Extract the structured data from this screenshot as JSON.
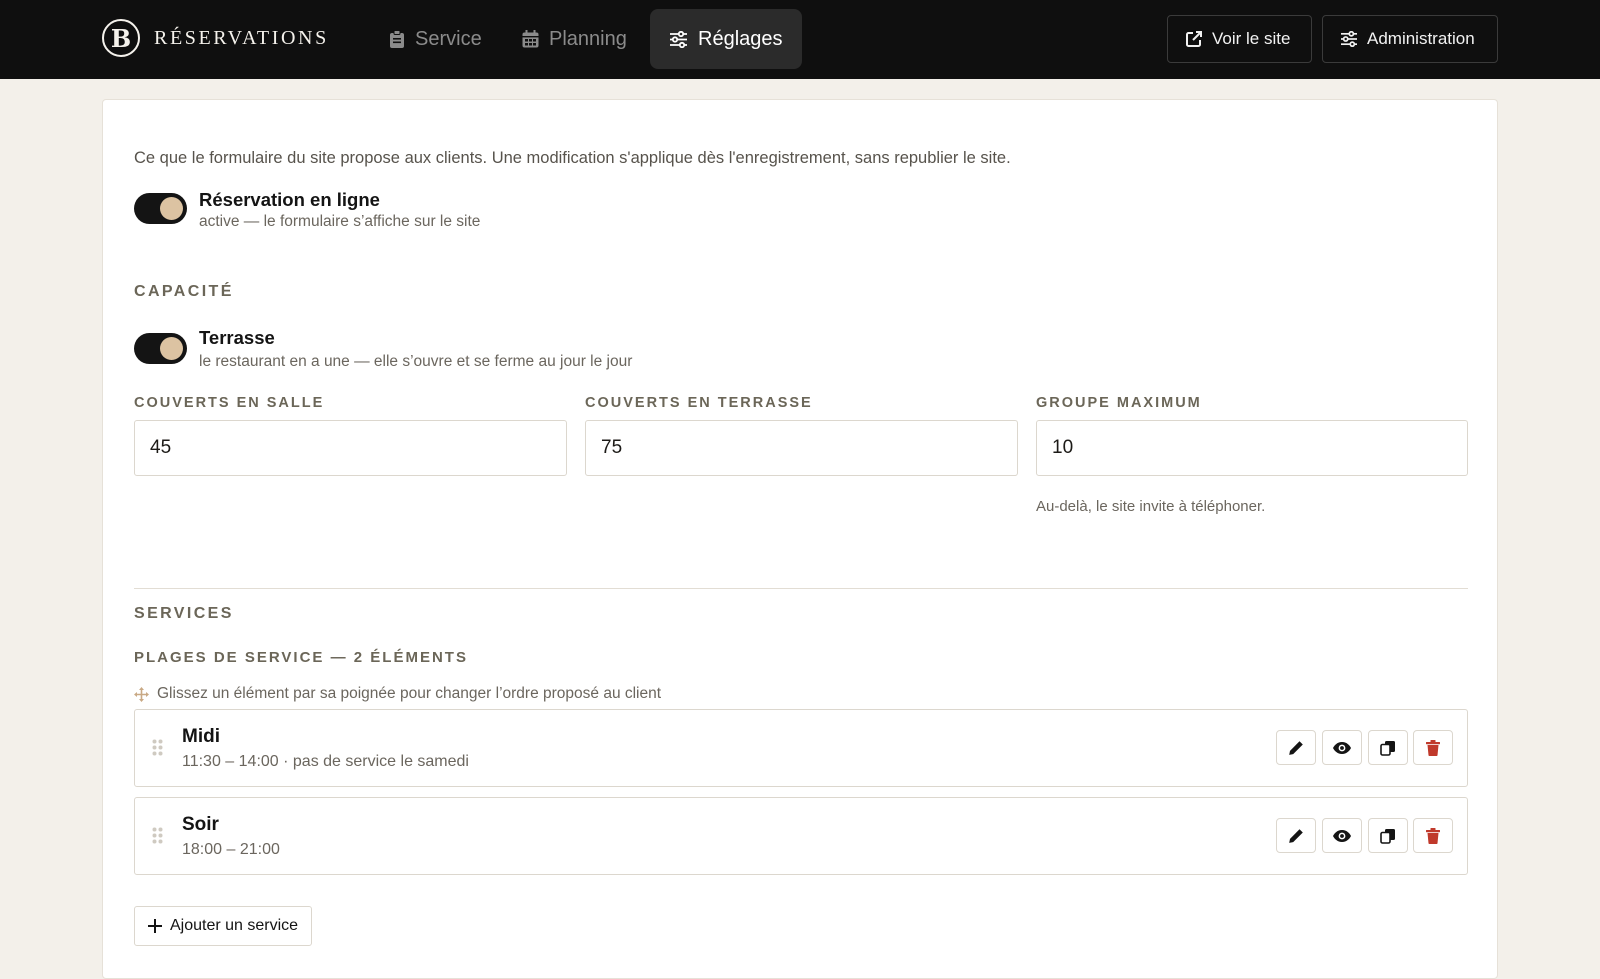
{
  "brand": {
    "logo_letter": "B",
    "name": "RÉSERVATIONS"
  },
  "nav": {
    "tabs": [
      {
        "label": "Service",
        "icon": "clipboard-icon",
        "active": false
      },
      {
        "label": "Planning",
        "icon": "calendar-icon",
        "active": false
      },
      {
        "label": "Réglages",
        "icon": "sliders-icon",
        "active": true
      }
    ],
    "view_site_label": "Voir le site",
    "admin_label": "Administration"
  },
  "settings": {
    "intro": "Ce que le formulaire du site propose aux clients. Une modification s'applique dès l'enregistrement, sans republier le site.",
    "online_booking": {
      "title": "Réservation en ligne",
      "desc": "active — le formulaire s’affiche sur le site",
      "enabled": true
    },
    "capacity": {
      "section_title": "CAPACITÉ",
      "terrace": {
        "title": "Terrasse",
        "desc": "le restaurant en a une — elle s’ouvre et se ferme au jour le jour",
        "enabled": true
      },
      "fields": {
        "indoor": {
          "label": "COUVERTS EN SALLE",
          "value": "45"
        },
        "terrace": {
          "label": "COUVERTS EN TERRASSE",
          "value": "75"
        },
        "max_group": {
          "label": "GROUPE MAXIMUM",
          "value": "10"
        }
      },
      "max_group_hint": "Au-delà, le site invite à téléphoner."
    },
    "services": {
      "section_title": "SERVICES",
      "list_title": "PLAGES DE SERVICE — 2 ÉLÉMENTS",
      "drag_hint": "Glissez un élément par sa poignée pour changer l’ordre proposé au client",
      "items": [
        {
          "name": "Midi",
          "detail": "11:30 – 14:00 · pas de service le samedi"
        },
        {
          "name": "Soir",
          "detail": "18:00 – 21:00"
        }
      ],
      "add_label": "Ajouter un service"
    }
  },
  "colors": {
    "topbar": "#0f0f0f",
    "page_background": "#f3f0ea",
    "toggle_knob": "#dcc3a2",
    "danger": "#c0392b",
    "accent_handle": "#c9a985"
  }
}
